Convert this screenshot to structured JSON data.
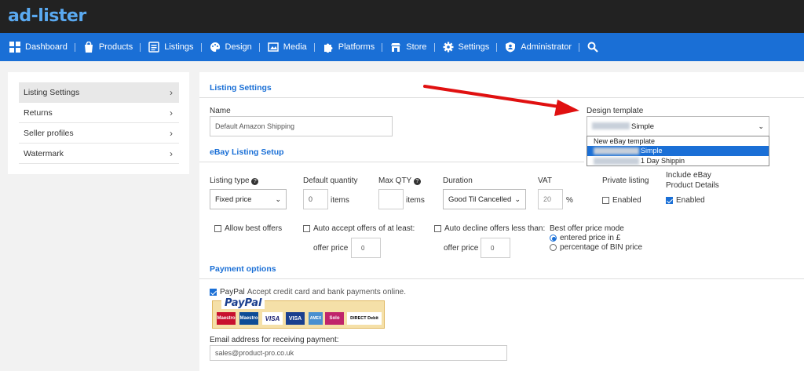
{
  "logo": "ad-lister",
  "nav": [
    {
      "label": "Dashboard",
      "icon": "dashboard-icon"
    },
    {
      "label": "Products",
      "icon": "bag-icon"
    },
    {
      "label": "Listings",
      "icon": "list-icon"
    },
    {
      "label": "Design",
      "icon": "palette-icon"
    },
    {
      "label": "Media",
      "icon": "image-icon"
    },
    {
      "label": "Platforms",
      "icon": "puzzle-icon"
    },
    {
      "label": "Store",
      "icon": "store-icon"
    },
    {
      "label": "Settings",
      "icon": "gear-icon"
    },
    {
      "label": "Administrator",
      "icon": "shield-icon"
    }
  ],
  "sidebar": {
    "items": [
      {
        "label": "Listing Settings"
      },
      {
        "label": "Returns"
      },
      {
        "label": "Seller profiles"
      },
      {
        "label": "Watermark"
      }
    ]
  },
  "listing_settings": {
    "title": "Listing Settings",
    "name_label": "Name",
    "name_value": "Default Amazon Shipping",
    "design_label": "Design template",
    "design_value": "Simple",
    "dropdown_options": [
      "New eBay template",
      "Simple",
      "1 Day Shippin"
    ]
  },
  "ebay": {
    "title": "eBay Listing Setup",
    "listing_type_label": "Listing type",
    "listing_type_value": "Fixed price",
    "default_qty_label": "Default quantity",
    "default_qty_value": "0",
    "items_unit": "items",
    "max_qty_label": "Max QTY",
    "max_qty_value": "",
    "duration_label": "Duration",
    "duration_value": "Good Til Cancelled",
    "vat_label": "VAT",
    "vat_value": "20",
    "vat_unit": "%",
    "private_label": "Private listing",
    "private_option": "Enabled",
    "include_label_1": "Include eBay",
    "include_label_2": "Product Details",
    "include_option": "Enabled",
    "allow_best": "Allow best offers",
    "auto_accept": "Auto accept offers of at least:",
    "auto_decline": "Auto decline offers less than:",
    "offer_price_label": "offer price",
    "accept_value": "0",
    "decline_value": "0",
    "best_mode_label": "Best offer price mode",
    "best_mode_opt1": "entered price in £",
    "best_mode_opt2": "percentage of BIN price"
  },
  "payment": {
    "title": "Payment options",
    "paypal_brand": "PayPal",
    "paypal_text": "Accept credit card and bank payments online.",
    "paypal_logo": "PayPal",
    "cards": [
      "Maestro",
      "Maestro",
      "VISA",
      "VISA",
      "AMEX",
      "Solo",
      "DIRECT Debit"
    ],
    "email_label": "Email address for receiving payment:",
    "email_value": "sales@product-pro.co.uk"
  },
  "colors": {
    "accent": "#1a6fd6",
    "topbar": "#222222",
    "arrow": "#e01010"
  }
}
